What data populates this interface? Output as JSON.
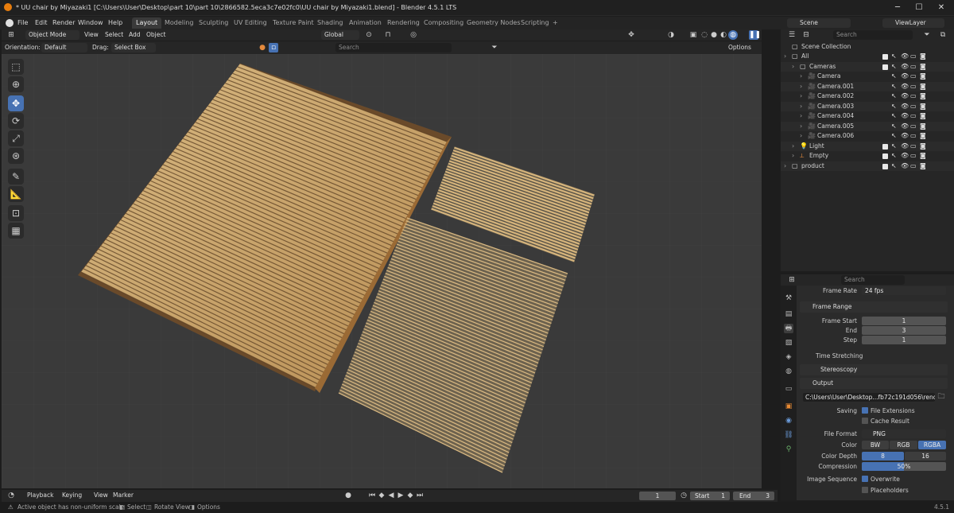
{
  "window": {
    "title": "* UU chair by Miyazaki1 [C:\\Users\\User\\Desktop\\part 10\\part 10\\2866582.5eca3c7e02fc0\\UU chair by Miyazaki1.blend] - Blender 4.5.1 LTS",
    "minimize": "─",
    "maximize": "☐",
    "close": "✕"
  },
  "menu": [
    "File",
    "Edit",
    "Render",
    "Window",
    "Help"
  ],
  "workspaces": [
    "Layout",
    "Modeling",
    "Sculpting",
    "UV Editing",
    "Texture Paint",
    "Shading",
    "Animation",
    "Rendering",
    "Compositing",
    "Geometry Nodes",
    "Scripting"
  ],
  "active_workspace": "Layout",
  "scene": {
    "label": "Scene",
    "view_layer": "ViewLayer"
  },
  "viewport_header": {
    "mode": "Object Mode",
    "menus": [
      "View",
      "Select",
      "Add",
      "Object"
    ],
    "transform_orientation": "Global"
  },
  "tool_settings": {
    "orientation_label": "Orientation:",
    "orientation_value": "Default",
    "drag_label": "Drag:",
    "drag_value": "Select Box",
    "search_placeholder": "Search",
    "options": "Options"
  },
  "toolbar_icons": [
    "select-box-icon",
    "cursor-icon",
    "move-icon",
    "rotate-icon",
    "scale-icon",
    "transform-icon",
    "annotate-icon",
    "measure-icon",
    "add-cube-icon",
    "add-object-icon"
  ],
  "outliner": {
    "search_placeholder": "Search",
    "root": "Scene Collection",
    "rows": [
      {
        "label": "All",
        "indent": 0
      },
      {
        "label": "Cameras",
        "indent": 1
      },
      {
        "label": "Camera",
        "indent": 2
      },
      {
        "label": "Camera.001",
        "indent": 2
      },
      {
        "label": "Camera.002",
        "indent": 2
      },
      {
        "label": "Camera.003",
        "indent": 2
      },
      {
        "label": "Camera.004",
        "indent": 2
      },
      {
        "label": "Camera.005",
        "indent": 2
      },
      {
        "label": "Camera.006",
        "indent": 2
      },
      {
        "label": "Light",
        "indent": 1
      },
      {
        "label": "Empty",
        "indent": 1
      },
      {
        "label": "product",
        "indent": 0
      }
    ]
  },
  "properties": {
    "search_placeholder": "Search",
    "frame_rate_label": "Frame Rate",
    "frame_rate_value": "24 fps",
    "frame_range_header": "Frame Range",
    "frame_start_label": "Frame Start",
    "frame_start": "1",
    "end_label": "End",
    "end": "3",
    "step_label": "Step",
    "step": "1",
    "time_stretching": "Time Stretching",
    "stereoscopy": "Stereoscopy",
    "output_header": "Output",
    "output_path": "C:\\Users\\User\\Desktop...fb72c191d056\\render",
    "saving_label": "Saving",
    "file_extensions": "File Extensions",
    "cache_result": "Cache Result",
    "file_format_label": "File Format",
    "file_format": "PNG",
    "color_label": "Color",
    "color_options": [
      "BW",
      "RGB",
      "RGBA"
    ],
    "color_selected": "RGBA",
    "color_depth_label": "Color Depth",
    "color_depth_options": [
      "8",
      "16"
    ],
    "color_depth_selected": "8",
    "compression_label": "Compression",
    "compression": "50%",
    "compression_fraction": 0.5,
    "image_sequence_label": "Image Sequence",
    "overwrite": "Overwrite",
    "placeholders": "Placeholders"
  },
  "timeline": {
    "menus": [
      "Playback",
      "Keying",
      "View",
      "Marker"
    ],
    "current_frame": "1",
    "start_label": "Start",
    "start": "1",
    "end_label": "End",
    "end": "3"
  },
  "status": {
    "warning": "Active object has non-uniform scale",
    "hints": [
      "Select",
      "Rotate View",
      "Options"
    ],
    "version": "4.5.1"
  },
  "colors": {
    "accent": "#4772b3",
    "viewport_bg": "#3a3a3a",
    "panel": "#2b2b2b",
    "bamboo": "#c9a66b"
  }
}
